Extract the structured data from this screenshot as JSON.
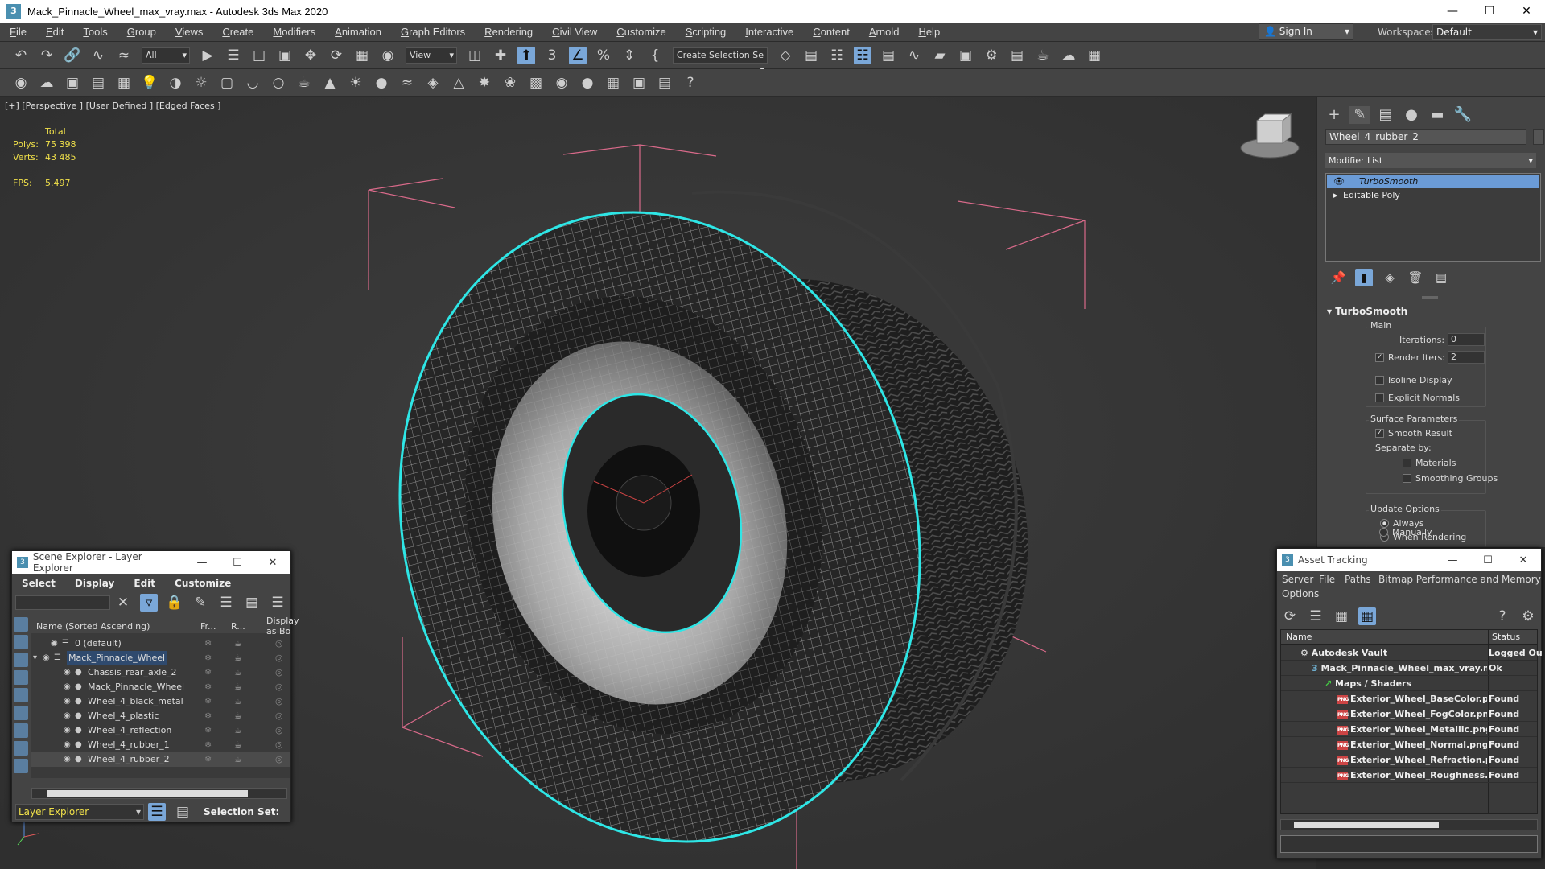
{
  "window": {
    "title": "Mack_Pinnacle_Wheel_max_vray.max - Autodesk 3ds Max 2020",
    "app_icon": "3"
  },
  "menu": [
    {
      "u": "F",
      "rest": "ile"
    },
    {
      "u": "E",
      "rest": "dit"
    },
    {
      "u": "T",
      "rest": "ools"
    },
    {
      "u": "G",
      "rest": "roup"
    },
    {
      "u": "V",
      "rest": "iews"
    },
    {
      "u": "C",
      "rest": "reate"
    },
    {
      "u": "M",
      "rest": "odifiers"
    },
    {
      "u": "A",
      "rest": "nimation"
    },
    {
      "u": "G",
      "rest": "raph Editors"
    },
    {
      "u": "R",
      "rest": "endering"
    },
    {
      "u": "C",
      "rest": "ivil View"
    },
    {
      "u": "C",
      "rest": "ustomize"
    },
    {
      "u": "S",
      "rest": "cripting"
    },
    {
      "u": "I",
      "rest": "nteractive"
    },
    {
      "u": "C",
      "rest": "ontent"
    },
    {
      "u": "A",
      "rest": "rnold"
    },
    {
      "u": "H",
      "rest": "elp"
    }
  ],
  "account": {
    "sign_in": "Sign In",
    "workspaces_label": "Workspaces:",
    "workspace": "Default"
  },
  "toolbar": {
    "filter": "All",
    "ref_coord": "View",
    "selection_set": "Create Selection Se"
  },
  "viewport": {
    "label": "[+] [Perspective ] [User Defined ] [Edged Faces ]",
    "stats": {
      "total_label": "Total",
      "polys_label": "Polys:",
      "polys": "75 398",
      "verts_label": "Verts:",
      "verts": "43 485",
      "fps_label": "FPS:",
      "fps": "5.497"
    },
    "colors": {
      "wire": "#e8e8e8",
      "selection": "#2ee6e6",
      "bbox": "#d96a8a"
    }
  },
  "command_panel": {
    "object_name": "Wheel_4_rubber_2",
    "modifier_list": "Modifier List",
    "stack": [
      "TurboSmooth",
      "Editable Poly"
    ],
    "rollout": "TurboSmooth",
    "main_label": "Main",
    "iterations_label": "Iterations:",
    "iterations": "0",
    "render_iters_label": "Render Iters:",
    "render_iters": "2",
    "isoline": "Isoline Display",
    "explicit": "Explicit Normals",
    "surface_label": "Surface Parameters",
    "smooth_result": "Smooth Result",
    "separate_by": "Separate by:",
    "materials": "Materials",
    "smoothing_groups": "Smoothing Groups",
    "update_label": "Update Options",
    "always": "Always",
    "when_rendering": "When Rendering",
    "manually": "Manually"
  },
  "scene_explorer": {
    "title": "Scene Explorer - Layer Explorer",
    "menu": [
      "Select",
      "Display",
      "Edit",
      "Customize"
    ],
    "columns": [
      "Name (Sorted Ascending)",
      "Fr...",
      "R...",
      "Display as Bo"
    ],
    "rows": [
      {
        "name": "0 (default)",
        "indent": 0
      },
      {
        "name": "Mack_Pinnacle_Wheel",
        "indent": 1
      },
      {
        "name": "Chassis_rear_axle_2",
        "indent": 2
      },
      {
        "name": "Mack_Pinnacle_Wheel",
        "indent": 2
      },
      {
        "name": "Wheel_4_black_metal",
        "indent": 2
      },
      {
        "name": "Wheel_4_plastic",
        "indent": 2
      },
      {
        "name": "Wheel_4_reflection",
        "indent": 2
      },
      {
        "name": "Wheel_4_rubber_1",
        "indent": 2
      },
      {
        "name": "Wheel_4_rubber_2",
        "indent": 2
      }
    ],
    "footer_layer": "Layer Explorer",
    "selection_set_label": "Selection Set:"
  },
  "asset_tracking": {
    "title": "Asset Tracking",
    "menu": [
      "Server",
      "File",
      "Paths",
      "Bitmap Performance and Memory",
      "Options"
    ],
    "columns": [
      "Name",
      "Status"
    ],
    "rows": [
      {
        "name": "Autodesk Vault",
        "status": "Logged Ou"
      },
      {
        "name": "Mack_Pinnacle_Wheel_max_vray.max",
        "status": "Ok"
      },
      {
        "name": "Maps / Shaders",
        "status": ""
      },
      {
        "name": "Exterior_Wheel_BaseColor.png",
        "status": "Found"
      },
      {
        "name": "Exterior_Wheel_FogColor.png",
        "status": "Found"
      },
      {
        "name": "Exterior_Wheel_Metallic.png",
        "status": "Found"
      },
      {
        "name": "Exterior_Wheel_Normal.png",
        "status": "Found"
      },
      {
        "name": "Exterior_Wheel_Refraction.png",
        "status": "Found"
      },
      {
        "name": "Exterior_Wheel_Roughness.png",
        "status": "Found"
      }
    ]
  }
}
